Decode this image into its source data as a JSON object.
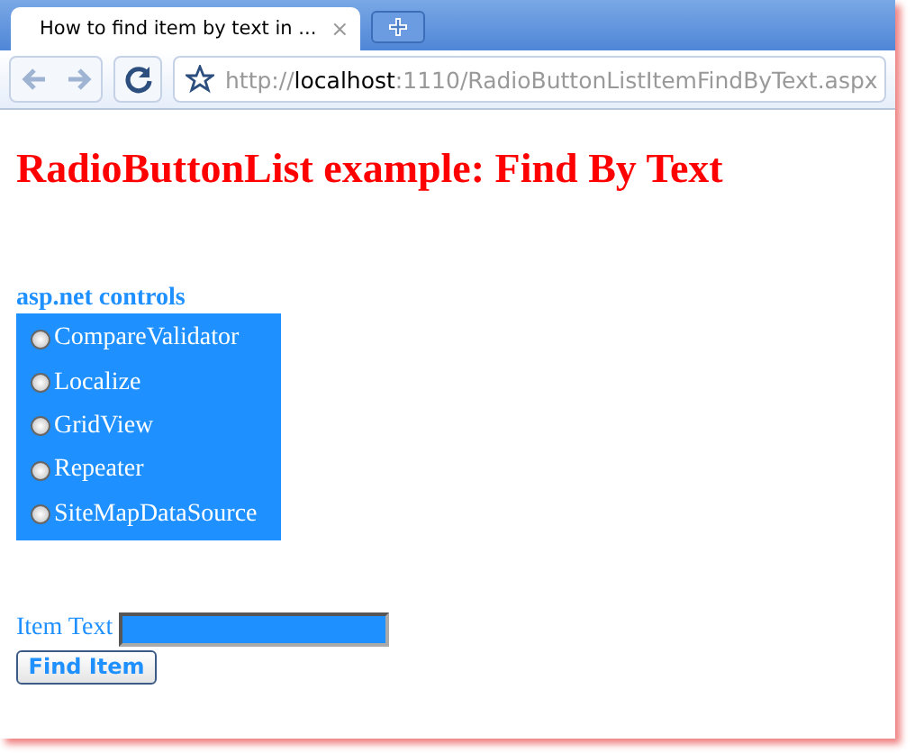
{
  "tab": {
    "title": "How to find item by text in ...",
    "close": "×"
  },
  "address": {
    "scheme": "http://",
    "host": "localhost",
    "rest": ":1110/RadioButtonListItemFindByText.aspx"
  },
  "heading": "RadioButtonList example: Find By Text",
  "list_label": "asp.net controls",
  "options": [
    {
      "label": "CompareValidator",
      "selected": false
    },
    {
      "label": "Localize",
      "selected": false
    },
    {
      "label": "GridView",
      "selected": false
    },
    {
      "label": "Repeater",
      "selected": false
    },
    {
      "label": "SiteMapDataSource",
      "selected": false
    }
  ],
  "field_label": "Item Text",
  "button": "Find Item"
}
